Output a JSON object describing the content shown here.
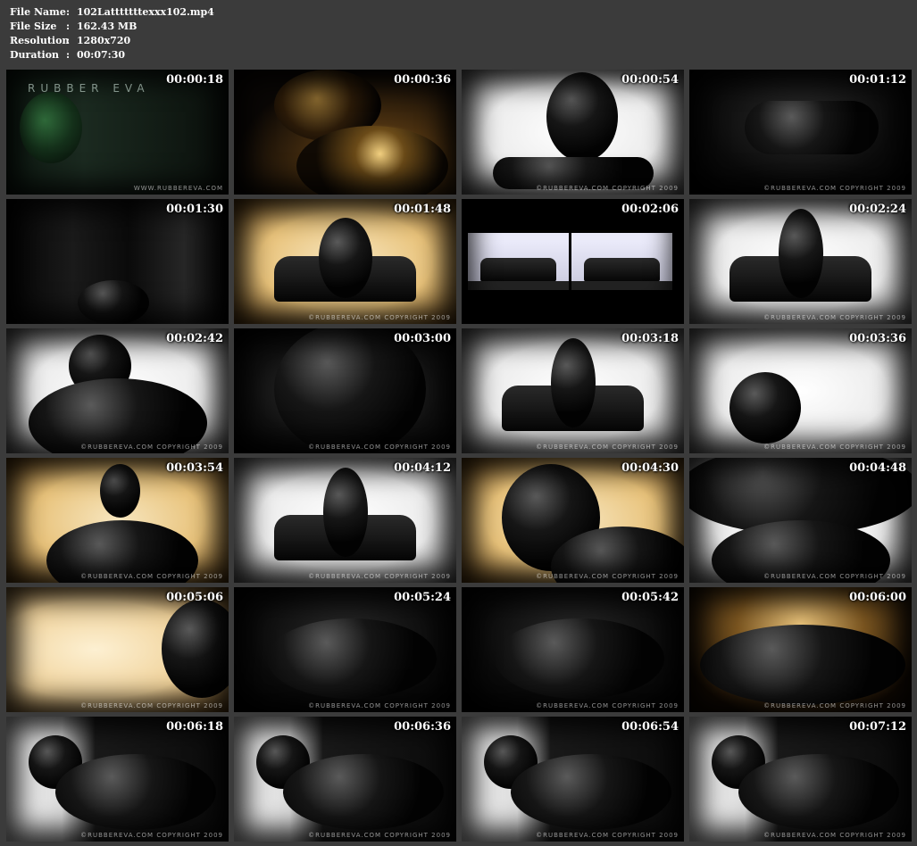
{
  "file_info": {
    "rows": [
      {
        "label": "File Name",
        "sep": ":",
        "value": "102Latttttttexxx102.mp4"
      },
      {
        "label": "File Size",
        "sep": ":",
        "value": "162.43 MB"
      },
      {
        "label": "Resolution",
        "sep": ":",
        "value": "1280x720"
      },
      {
        "label": "Duration",
        "sep": ":",
        "value": "00:07:30"
      }
    ]
  },
  "thumbnails": [
    {
      "timestamp": "00:00:18",
      "scene": "intro-mask",
      "brand": "RUBBER EVA",
      "watermark": "WWW.RUBBEREVA.COM"
    },
    {
      "timestamp": "00:00:36",
      "scene": "dark-gold",
      "watermark": ""
    },
    {
      "timestamp": "00:00:54",
      "scene": "white-hood",
      "watermark": "©RUBBEREVA.COM COPYRIGHT 2009"
    },
    {
      "timestamp": "00:01:12",
      "scene": "dark-reclining",
      "watermark": "©RUBBEREVA.COM COPYRIGHT 2009"
    },
    {
      "timestamp": "00:01:30",
      "scene": "dark-room",
      "watermark": ""
    },
    {
      "timestamp": "00:01:48",
      "scene": "sofa-warm",
      "watermark": "©RUBBEREVA.COM COPYRIGHT 2009"
    },
    {
      "timestamp": "00:02:06",
      "scene": "split-sofa",
      "watermark": ""
    },
    {
      "timestamp": "00:02:24",
      "scene": "sofa-white",
      "watermark": "©RUBBEREVA.COM COPYRIGHT 2009"
    },
    {
      "timestamp": "00:02:42",
      "scene": "white-closeup",
      "watermark": "©RUBBEREVA.COM COPYRIGHT 2009"
    },
    {
      "timestamp": "00:03:00",
      "scene": "dark-closeup",
      "watermark": "©RUBBEREVA.COM COPYRIGHT 2009"
    },
    {
      "timestamp": "00:03:18",
      "scene": "sofa-white",
      "watermark": "©RUBBEREVA.COM COPYRIGHT 2009"
    },
    {
      "timestamp": "00:03:36",
      "scene": "white-hand",
      "watermark": "©RUBBEREVA.COM COPYRIGHT 2009"
    },
    {
      "timestamp": "00:03:54",
      "scene": "warm-figure",
      "watermark": "©RUBBEREVA.COM COPYRIGHT 2009"
    },
    {
      "timestamp": "00:04:12",
      "scene": "sofa-white",
      "watermark": "©RUBBEREVA.COM COPYRIGHT 2009"
    },
    {
      "timestamp": "00:04:30",
      "scene": "warm-hood",
      "watermark": "©RUBBEREVA.COM COPYRIGHT 2009"
    },
    {
      "timestamp": "00:04:48",
      "scene": "white-arm",
      "watermark": "©RUBBEREVA.COM COPYRIGHT 2009"
    },
    {
      "timestamp": "00:05:06",
      "scene": "warm-profile",
      "watermark": "©RUBBEREVA.COM COPYRIGHT 2009"
    },
    {
      "timestamp": "00:05:24",
      "scene": "dark-lying",
      "watermark": "©RUBBEREVA.COM COPYRIGHT 2009"
    },
    {
      "timestamp": "00:05:42",
      "scene": "dark-lying",
      "watermark": "©RUBBEREVA.COM COPYRIGHT 2009"
    },
    {
      "timestamp": "00:06:00",
      "scene": "warm-lying",
      "watermark": "©RUBBEREVA.COM COPYRIGHT 2009"
    },
    {
      "timestamp": "00:06:18",
      "scene": "white-lying",
      "watermark": "©RUBBEREVA.COM COPYRIGHT 2009"
    },
    {
      "timestamp": "00:06:36",
      "scene": "white-lying",
      "watermark": "©RUBBEREVA.COM COPYRIGHT 2009"
    },
    {
      "timestamp": "00:06:54",
      "scene": "white-lying",
      "watermark": "©RUBBEREVA.COM COPYRIGHT 2009"
    },
    {
      "timestamp": "00:07:12",
      "scene": "white-lying",
      "watermark": "©RUBBEREVA.COM COPYRIGHT 2009"
    }
  ],
  "colors": {
    "page_background": "#3b3b3b",
    "text": "#ffffff",
    "warm_light": "#f3d9a0",
    "white_light": "#f4f4f4",
    "gold": "#c89a40"
  }
}
